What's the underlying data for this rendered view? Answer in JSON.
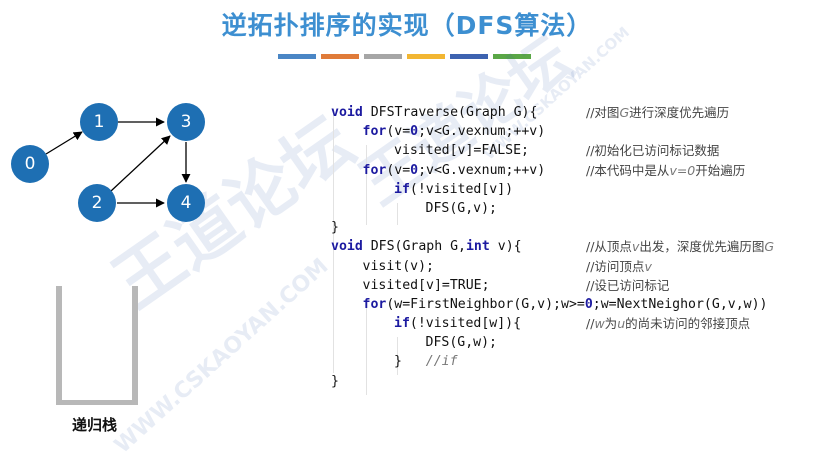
{
  "slide": {
    "title": "逆拓扑排序的实现（DFS算法）",
    "title_color": "#3d8fd1",
    "color_bar": [
      "#4a86c5",
      "#e07b39",
      "#a6a6a6",
      "#f2b632",
      "#3d63b0",
      "#5aa746"
    ]
  },
  "graph": {
    "node_color": "#1e6fb3",
    "nodes": [
      "0",
      "1",
      "2",
      "3",
      "4"
    ]
  },
  "stack": {
    "label": "递归栈"
  },
  "code": {
    "lines": [
      {
        "indent": 0,
        "parts": [
          {
            "t": "void",
            "c": "kw"
          },
          {
            "t": " DFSTraverse(Graph G){"
          }
        ],
        "comment": [
          {
            "t": "//对图"
          },
          {
            "t": "G",
            "c": "ital"
          },
          {
            "t": "进行深度优先遍历"
          }
        ]
      },
      {
        "indent": 1,
        "parts": [
          {
            "t": "for",
            "c": "kw"
          },
          {
            "t": "(v="
          },
          {
            "t": "0",
            "c": "num"
          },
          {
            "t": ";v<G.vexnum;++v)"
          }
        ],
        "comment": []
      },
      {
        "indent": 2,
        "parts": [
          {
            "t": "visited[v]=FALSE;"
          }
        ],
        "comment": [
          {
            "t": "//初始化已访问标记数据"
          }
        ]
      },
      {
        "indent": 1,
        "parts": [
          {
            "t": "for",
            "c": "kw"
          },
          {
            "t": "(v="
          },
          {
            "t": "0",
            "c": "num"
          },
          {
            "t": ";v<G.vexnum;++v)"
          }
        ],
        "comment": [
          {
            "t": "//本代码中是从"
          },
          {
            "t": "v=0",
            "c": "ital"
          },
          {
            "t": "开始遍历"
          }
        ]
      },
      {
        "indent": 2,
        "parts": [
          {
            "t": "if",
            "c": "kw"
          },
          {
            "t": "(!visited[v])"
          }
        ],
        "comment": []
      },
      {
        "indent": 3,
        "parts": [
          {
            "t": "DFS(G,v);"
          }
        ],
        "comment": []
      },
      {
        "indent": 0,
        "parts": [
          {
            "t": "}"
          }
        ],
        "comment": []
      },
      {
        "indent": 0,
        "parts": [
          {
            "t": "void",
            "c": "kw"
          },
          {
            "t": " DFS(Graph G,"
          },
          {
            "t": "int",
            "c": "kw"
          },
          {
            "t": " v){"
          }
        ],
        "comment": [
          {
            "t": "//从顶点"
          },
          {
            "t": "v",
            "c": "ital"
          },
          {
            "t": "出发，深度优先遍历图"
          },
          {
            "t": "G",
            "c": "ital"
          }
        ]
      },
      {
        "indent": 1,
        "parts": [
          {
            "t": "visit(v);"
          }
        ],
        "comment": [
          {
            "t": "//访问顶点"
          },
          {
            "t": "v",
            "c": "ital"
          }
        ]
      },
      {
        "indent": 1,
        "parts": [
          {
            "t": "visited[v]=TRUE;"
          }
        ],
        "comment": [
          {
            "t": "//设已访问标记"
          }
        ]
      },
      {
        "indent": 1,
        "parts": [
          {
            "t": "for",
            "c": "kw"
          },
          {
            "t": "(w=FirstNeighbor(G,v);w>="
          },
          {
            "t": "0",
            "c": "num"
          },
          {
            "t": ";w=NextNeighor(G,v,w))"
          }
        ],
        "comment": []
      },
      {
        "indent": 2,
        "parts": [
          {
            "t": "if",
            "c": "kw"
          },
          {
            "t": "(!visited[w]){"
          }
        ],
        "comment": [
          {
            "t": "//"
          },
          {
            "t": "w",
            "c": "ital"
          },
          {
            "t": "为"
          },
          {
            "t": "u",
            "c": "ital"
          },
          {
            "t": "的尚未访问的邻接顶点"
          }
        ]
      },
      {
        "indent": 3,
        "parts": [
          {
            "t": "DFS(G,w);"
          }
        ],
        "comment": []
      },
      {
        "indent": 2,
        "parts": [
          {
            "t": "}   "
          },
          {
            "t": "//if",
            "c": "ital"
          }
        ],
        "comment": []
      },
      {
        "indent": 0,
        "parts": [
          {
            "t": "}"
          }
        ],
        "comment": []
      }
    ]
  },
  "watermarks": {
    "big": "王道论坛",
    "url": "WWW.CSKAOYAN.COM"
  }
}
